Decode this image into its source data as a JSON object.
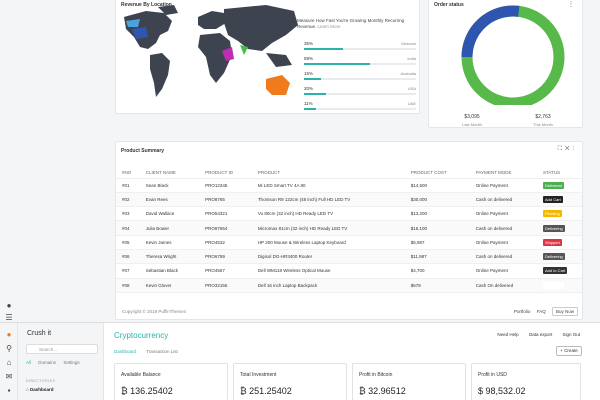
{
  "map_card": {
    "title": "Revenue By Location",
    "headline": "Measure How Fast You're Growing Monthly Recurring Revenue.",
    "learn_more": "Learn More",
    "stats": [
      {
        "pct": "35%",
        "country": "Moscow",
        "value": 0.35
      },
      {
        "pct": "59%",
        "country": "India",
        "value": 0.59
      },
      {
        "pct": "15%",
        "country": "Australia",
        "value": 0.15
      },
      {
        "pct": "20%",
        "country": "USA",
        "value": 0.2
      },
      {
        "pct": "11%",
        "country": "UAE",
        "value": 0.11
      }
    ]
  },
  "order_card": {
    "title": "Order status",
    "donut_labels": [
      "27.0%",
      "63.0%"
    ],
    "donut_values": [
      0.27,
      0.73
    ],
    "colors": {
      "blue": "#2e56b0",
      "green": "#57b94a"
    },
    "last_month_value": "$3,095",
    "last_month_label": "Last Month",
    "this_month_value": "$2,763",
    "this_month_label": "This Month"
  },
  "product_card": {
    "title": "Product Summary",
    "columns": [
      "#NO",
      "CLIENT NAME",
      "PRODUCT ID",
      "PRODUCT",
      "PRODUCT COST",
      "PAYMENT MODE",
      "STATUS"
    ],
    "rows": [
      {
        "no": "#01",
        "client": "Sean Black",
        "pid": "PRO12345",
        "product": "Mi LED Smart TV 4A 80",
        "cost": "$14,500",
        "mode": "Online Payment",
        "status": "Delivered",
        "color": "#4caf50"
      },
      {
        "no": "#02",
        "client": "Evan Rees",
        "pid": "PRO8765",
        "product": "Thomson R9 122cm (48 inch) Full HD LED TV",
        "cost": "$30,000",
        "mode": "Cash on delivered",
        "status": "Add Cart",
        "color": "#222222"
      },
      {
        "no": "#03",
        "client": "David Wallace",
        "pid": "PRO54321",
        "product": "Vu 80cm (32 inch) HD Ready LED TV",
        "cost": "$13,200",
        "mode": "Online Payment",
        "status": "Pending",
        "color": "#f5b800"
      },
      {
        "no": "#04",
        "client": "Julia Bower",
        "pid": "PRO97654",
        "product": "Micromax 81cm (32 inch) HD Ready LED TV",
        "cost": "$15,100",
        "mode": "Cash on delivered",
        "status": "Delivering",
        "color": "#555555"
      },
      {
        "no": "#05",
        "client": "Kevin James",
        "pid": "PRO4532",
        "product": "HP 200 Mouse & Wireless Laptop Keyboard",
        "cost": "$5,987",
        "mode": "Online Payment",
        "status": "Shipped",
        "color": "#dc3545"
      },
      {
        "no": "#06",
        "client": "Theresa Wright",
        "pid": "PRO6789",
        "product": "Digisol DG-HR3400 Router",
        "cost": "$11,987",
        "mode": "Cash on delivered",
        "status": "Delivering",
        "color": "#555555"
      },
      {
        "no": "#07",
        "client": "Sebastian Black",
        "pid": "PRO4567",
        "product": "Dell WM118 Wireless Optical Mouse",
        "cost": "$4,700",
        "mode": "Online Payment",
        "status": "Add to Cart",
        "color": "#333333"
      },
      {
        "no": "#08",
        "client": "Kevin Glover",
        "pid": "PRO32156",
        "product": "Dell 16 inch Laptop Backpack",
        "cost": "$678",
        "mode": "Cash On delivered",
        "status": "Delivered",
        "color": "#ffffff"
      }
    ],
    "copyright": "Copyright © 2019 PuffinThemes",
    "portfolio": "Portfolio",
    "faq": "FAQ",
    "buy_now": "Buy Now"
  },
  "bottom": {
    "sidebar_title": "Crush it",
    "search_placeholder": "Search...",
    "tabs": [
      "All",
      "Domains",
      "Settings"
    ],
    "section": "DIRECTORIES",
    "item": "Dashboard",
    "main_title": "Cryptocurrency",
    "main_tabs": [
      "Dashboard",
      "Transaction List"
    ],
    "links": [
      "Need Help",
      "Data export",
      "Sign Out"
    ],
    "create": "Create",
    "kpis": [
      {
        "label": "Available Balance",
        "value": "₿ 136.25402"
      },
      {
        "label": "Total Investment",
        "value": "₿ 251.25402"
      },
      {
        "label": "Profit in Bitcoin",
        "value": "₿ 32.96512"
      },
      {
        "label": "Profit in USD",
        "value": "$ 98,532.02"
      }
    ]
  }
}
